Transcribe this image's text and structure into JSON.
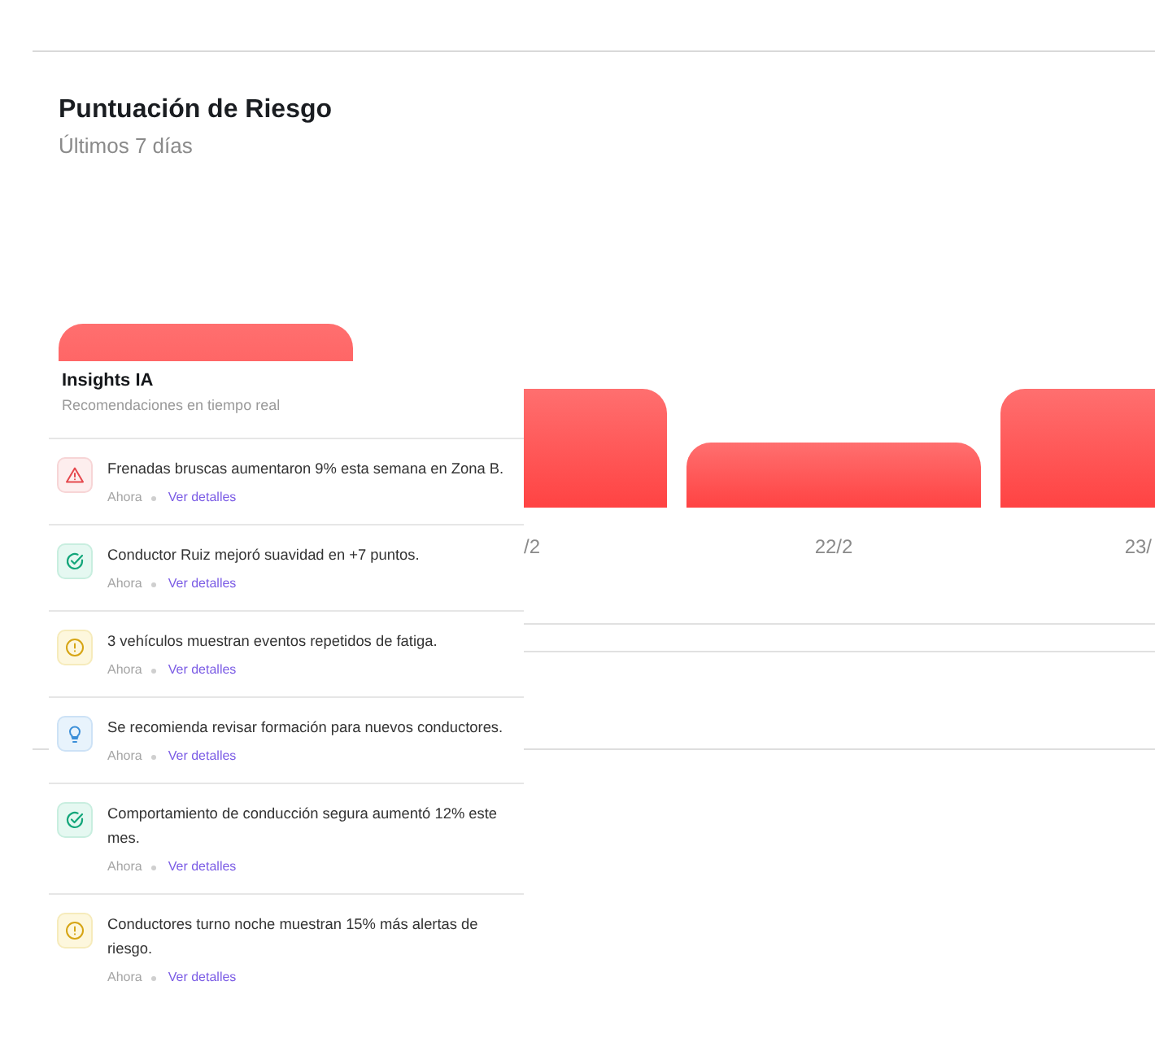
{
  "risk_card": {
    "title": "Puntuación de Riesgo",
    "subtitle": "Últimos 7 días",
    "x_labels": [
      "/2",
      "22/2",
      "23/"
    ]
  },
  "insights_panel": {
    "title": "Insights IA",
    "subtitle": "Recomendaciones en tiempo real",
    "items": [
      {
        "kind": "warning",
        "text": "Frenadas bruscas aumentaron 9% esta semana en Zona B.",
        "time": "Ahora",
        "link": "Ver detalles"
      },
      {
        "kind": "success",
        "text": "Conductor Ruiz mejoró suavidad en +7 puntos.",
        "time": "Ahora",
        "link": "Ver detalles"
      },
      {
        "kind": "alert",
        "text": "3 vehículos muestran eventos repetidos de fatiga.",
        "time": "Ahora",
        "link": "Ver detalles"
      },
      {
        "kind": "tip",
        "text": "Se recomienda revisar formación para nuevos conductores.",
        "time": "Ahora",
        "link": "Ver detalles"
      },
      {
        "kind": "success",
        "text": "Comportamiento de conducción segura aumentó 12% este mes.",
        "time": "Ahora",
        "link": "Ver detalles"
      },
      {
        "kind": "alert",
        "text": "Conductores turno noche muestran 15% más alertas de riesgo.",
        "time": "Ahora",
        "link": "Ver detalles"
      }
    ]
  }
}
